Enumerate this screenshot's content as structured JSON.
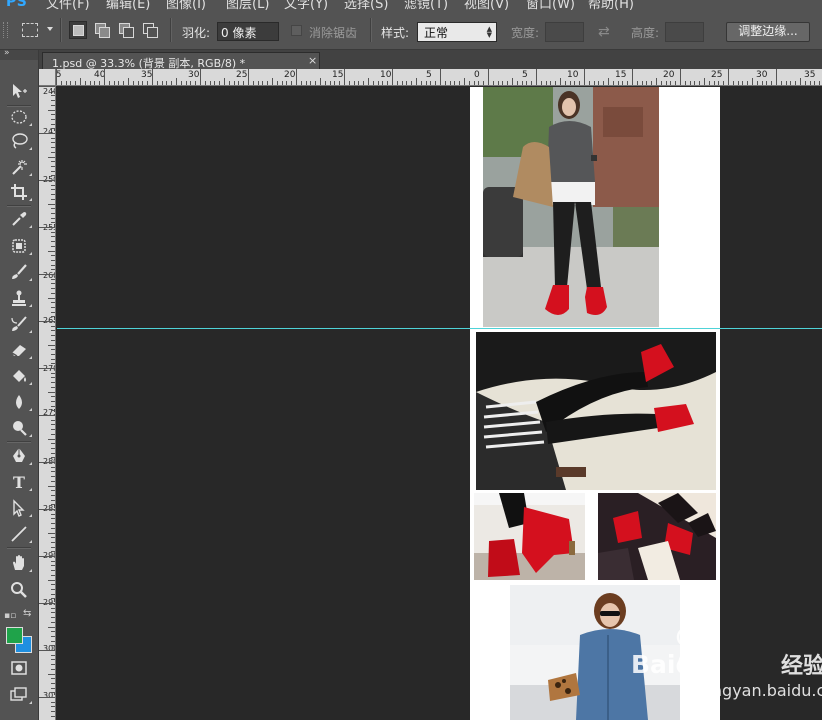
{
  "app": {
    "logo": "PS"
  },
  "menu": {
    "items": [
      "文件(F)",
      "编辑(E)",
      "图像(I)",
      "图层(L)",
      "文字(Y)",
      "选择(S)",
      "滤镜(T)",
      "视图(V)",
      "窗口(W)",
      "帮助(H)"
    ]
  },
  "options": {
    "feather_label": "羽化:",
    "feather_value": "0 像素",
    "antialias_label": "消除锯齿",
    "style_label": "样式:",
    "style_value": "正常",
    "width_label": "宽度:",
    "height_label": "高度:",
    "refine_edge_label": "调整边缘..."
  },
  "document_tab": {
    "label": "1.psd @ 33.3% (背景 副本, RGB/8) *",
    "close": "×"
  },
  "ruler": {
    "horizontal_labels": [
      "45",
      "40",
      "35",
      "30",
      "25",
      "20",
      "15",
      "10",
      "5",
      "0",
      "5",
      "10",
      "15",
      "20",
      "25",
      "30",
      "35"
    ],
    "vertical_labels": [
      "240",
      "245",
      "250",
      "255",
      "260",
      "265",
      "270",
      "275",
      "280",
      "285",
      "290",
      "295",
      "300",
      "305"
    ]
  },
  "tools": [
    "move-tool",
    "marquee-tool",
    "lasso-tool",
    "quick-selection-tool",
    "crop-tool",
    "eyedropper-tool",
    "healing-brush-tool",
    "brush-tool",
    "clone-stamp-tool",
    "history-brush-tool",
    "eraser-tool",
    "paint-bucket-tool",
    "blur-tool",
    "dodge-tool",
    "pen-tool",
    "type-tool",
    "path-selection-tool",
    "line-tool",
    "hand-tool",
    "zoom-tool"
  ],
  "colors": {
    "foreground": "#1fa34a",
    "background": "#1f8fe0",
    "guide": "#4fd3d8",
    "accent_boots": "#d4101e"
  },
  "watermark": {
    "brand": "Baidu",
    "brand_suffix": "经验",
    "url": "jingyan.baidu.com"
  }
}
